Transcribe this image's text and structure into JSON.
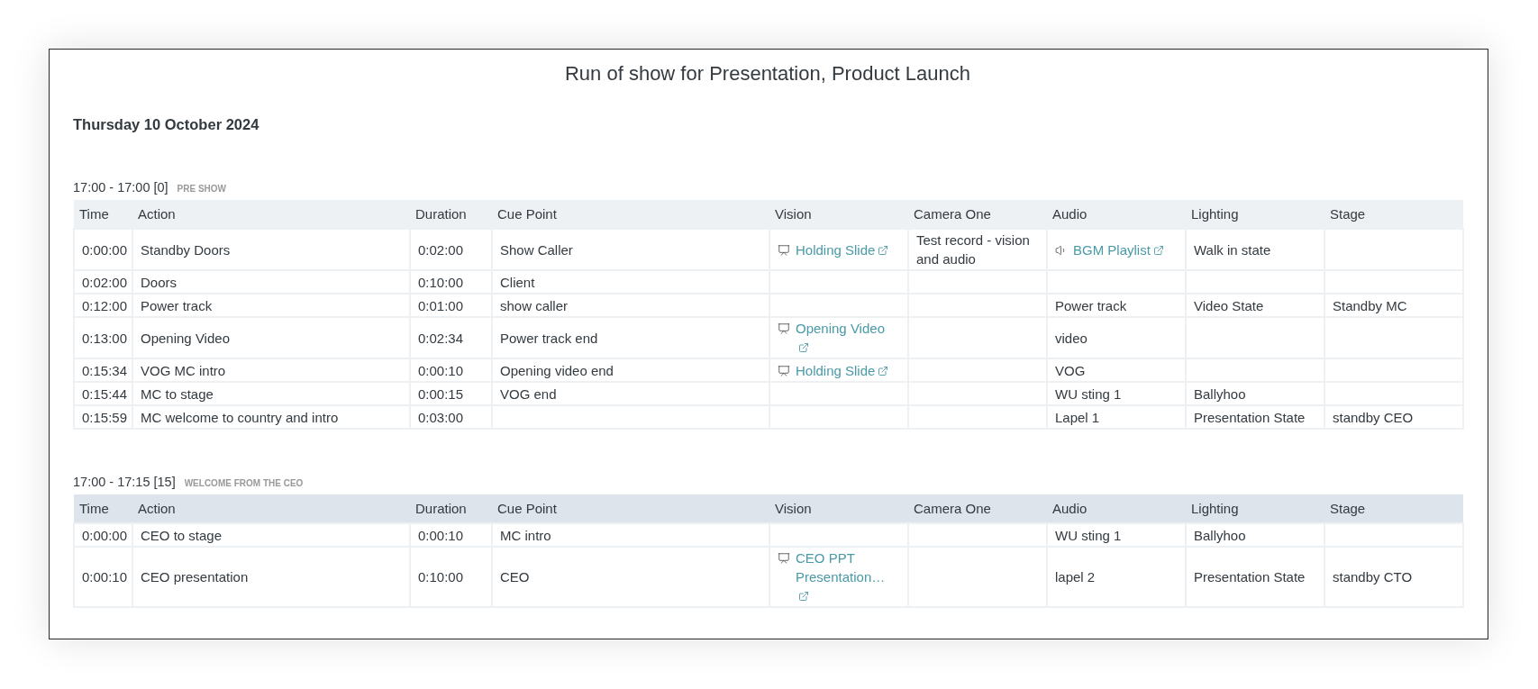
{
  "title": "Run of show for Presentation, Product Launch",
  "date": "Thursday 10 October 2024",
  "sections": [
    {
      "time_range": "17:00 - 17:00 [0]",
      "name": "PRE SHOW",
      "columns": [
        "Time",
        "Action",
        "Duration",
        "Cue Point",
        "Vision",
        "Camera One",
        "Audio",
        "Lighting",
        "Stage"
      ],
      "rows": [
        {
          "cells": [
            {
              "kind": "text",
              "text": "0:00:00"
            },
            {
              "kind": "text",
              "text": "Standby Doors"
            },
            {
              "kind": "text",
              "text": "0:02:00"
            },
            {
              "kind": "text",
              "text": "Show Caller"
            },
            {
              "kind": "slide-link",
              "text": "Holding Slide"
            },
            {
              "kind": "text",
              "text": "Test record - vision and audio"
            },
            {
              "kind": "audio-link",
              "text": "BGM Playlist"
            },
            {
              "kind": "text",
              "text": "Walk in state"
            },
            null
          ]
        },
        {
          "cells": [
            {
              "kind": "text",
              "text": "0:02:00"
            },
            {
              "kind": "text",
              "text": "Doors"
            },
            {
              "kind": "text",
              "text": "0:10:00"
            },
            {
              "kind": "text",
              "text": "Client"
            },
            null,
            null,
            null,
            null,
            null
          ]
        },
        {
          "cells": [
            {
              "kind": "text",
              "text": "0:12:00"
            },
            {
              "kind": "text",
              "text": "Power track"
            },
            {
              "kind": "text",
              "text": "0:01:00"
            },
            {
              "kind": "text",
              "text": "show caller"
            },
            null,
            null,
            {
              "kind": "text",
              "text": "Power track"
            },
            {
              "kind": "text",
              "text": "Video State"
            },
            {
              "kind": "text",
              "text": "Standby MC"
            }
          ]
        },
        {
          "cells": [
            {
              "kind": "text",
              "text": "0:13:00"
            },
            {
              "kind": "text",
              "text": "Opening Video"
            },
            {
              "kind": "text",
              "text": "0:02:34"
            },
            {
              "kind": "text",
              "text": "Power track end"
            },
            {
              "kind": "slide-link",
              "text": "Opening Video"
            },
            null,
            {
              "kind": "text",
              "text": "video"
            },
            null,
            null
          ]
        },
        {
          "cells": [
            {
              "kind": "text",
              "text": "0:15:34"
            },
            {
              "kind": "text",
              "text": "VOG MC intro"
            },
            {
              "kind": "text",
              "text": "0:00:10"
            },
            {
              "kind": "text",
              "text": "Opening video end"
            },
            {
              "kind": "slide-link",
              "text": "Holding Slide"
            },
            null,
            {
              "kind": "text",
              "text": "VOG"
            },
            null,
            null
          ]
        },
        {
          "cells": [
            {
              "kind": "text",
              "text": "0:15:44"
            },
            {
              "kind": "text",
              "text": "MC to stage"
            },
            {
              "kind": "text",
              "text": "0:00:15"
            },
            {
              "kind": "text",
              "text": "VOG end"
            },
            null,
            null,
            {
              "kind": "text",
              "text": "WU sting 1"
            },
            {
              "kind": "text",
              "text": "Ballyhoo"
            },
            null
          ]
        },
        {
          "cells": [
            {
              "kind": "text",
              "text": "0:15:59"
            },
            {
              "kind": "text",
              "text": "MC welcome to country and intro"
            },
            {
              "kind": "text",
              "text": "0:03:00"
            },
            null,
            null,
            null,
            {
              "kind": "text",
              "text": "Lapel 1"
            },
            {
              "kind": "text",
              "text": "Presentation State"
            },
            {
              "kind": "text",
              "text": "standby CEO"
            }
          ]
        }
      ]
    },
    {
      "time_range": "17:00 - 17:15 [15]",
      "name": "WELCOME FROM THE CEO",
      "columns": [
        "Time",
        "Action",
        "Duration",
        "Cue Point",
        "Vision",
        "Camera One",
        "Audio",
        "Lighting",
        "Stage"
      ],
      "rows": [
        {
          "cells": [
            {
              "kind": "text",
              "text": "0:00:00"
            },
            {
              "kind": "text",
              "text": "CEO to stage"
            },
            {
              "kind": "text",
              "text": "0:00:10"
            },
            {
              "kind": "text",
              "text": "MC intro"
            },
            null,
            null,
            {
              "kind": "text",
              "text": "WU sting 1"
            },
            {
              "kind": "text",
              "text": "Ballyhoo"
            },
            null
          ]
        },
        {
          "cells": [
            {
              "kind": "text",
              "text": "0:00:10"
            },
            {
              "kind": "text",
              "text": "CEO presentation"
            },
            {
              "kind": "text",
              "text": "0:10:00"
            },
            {
              "kind": "text",
              "text": "CEO"
            },
            {
              "kind": "slide-link",
              "text": "CEO PPT Presentation…"
            },
            null,
            {
              "kind": "text",
              "text": "lapel 2"
            },
            {
              "kind": "text",
              "text": "Presentation State"
            },
            {
              "kind": "text",
              "text": "standby CTO"
            }
          ]
        }
      ]
    }
  ]
}
